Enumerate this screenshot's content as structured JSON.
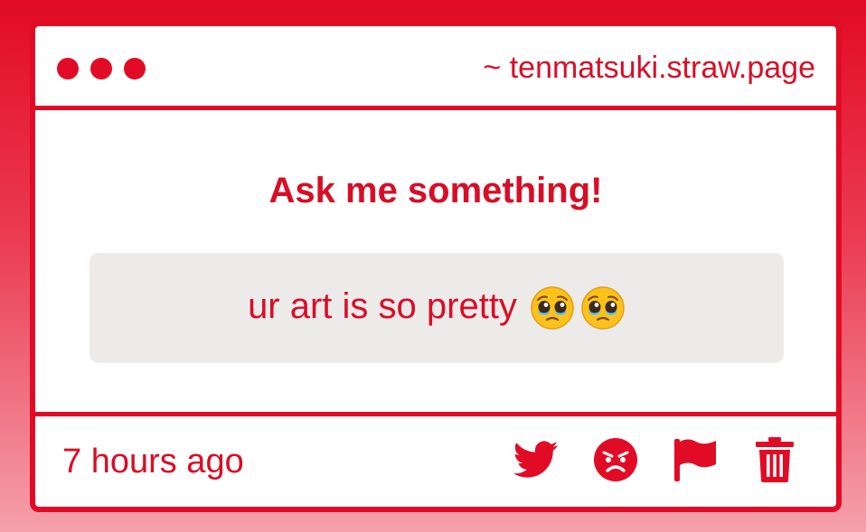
{
  "window": {
    "url": "~ tenmatsuki.straw.page"
  },
  "question": {
    "heading": "Ask me something!",
    "text": "ur art is so pretty",
    "emojis": [
      "pleading-face-icon",
      "pleading-face-icon"
    ]
  },
  "footer": {
    "timestamp": "7 hours ago",
    "actions": [
      "twitter-icon",
      "angry-face-icon",
      "flag-icon",
      "trash-icon"
    ]
  },
  "colors": {
    "accent": "#e20b25",
    "text": "#d80e26",
    "question_bg": "#edeaea"
  }
}
